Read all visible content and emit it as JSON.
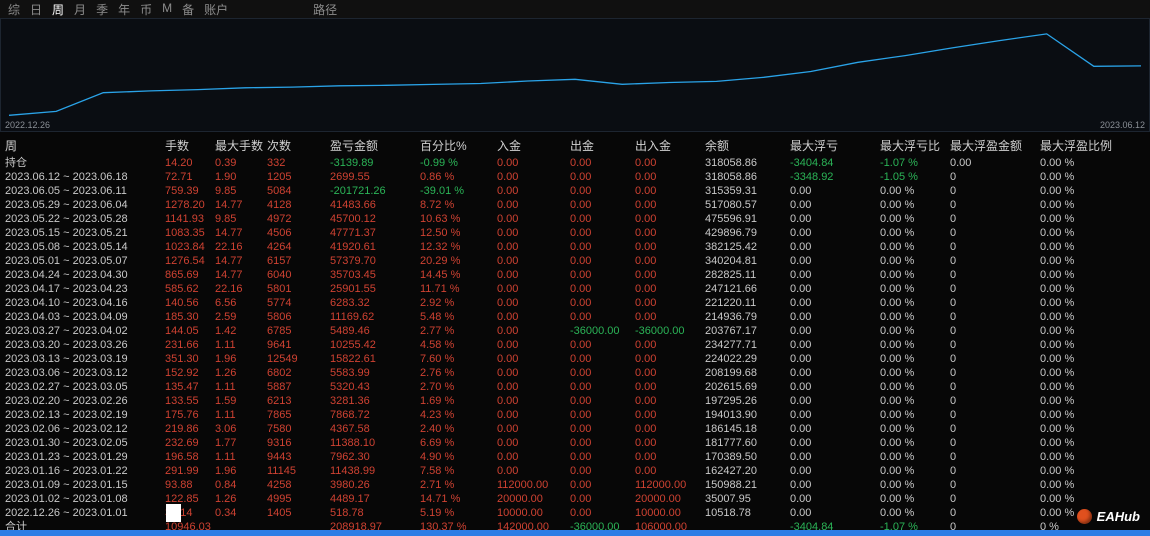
{
  "colors": {
    "positive": "#cf4232",
    "negative": "#2bb457",
    "neutral_text": "#c9c9c9",
    "menu_active": "#ffffff",
    "menu_inactive": "#8c8c8c",
    "chart_line": "#2aa3e8",
    "scrollbar": "#2e7de5",
    "logo_orange": "#e0501e"
  },
  "menu": {
    "tabs": [
      {
        "label": "综",
        "active": false
      },
      {
        "label": "日",
        "active": false
      },
      {
        "label": "周",
        "active": true
      },
      {
        "label": "月",
        "active": false
      },
      {
        "label": "季",
        "active": false
      },
      {
        "label": "年",
        "active": false
      },
      {
        "label": "币",
        "active": false
      },
      {
        "label": "M",
        "active": false
      },
      {
        "label": "备",
        "active": false
      },
      {
        "label": "账户",
        "active": false
      },
      {
        "label": "路径",
        "active": false,
        "gap_before": true
      }
    ]
  },
  "chart": {
    "start_date": "2022.12.26",
    "end_date": "2023.06.12"
  },
  "chart_data": {
    "type": "line",
    "title": "",
    "xlabel": "",
    "ylabel": "",
    "legend": false,
    "grid": false,
    "ylim": [
      0,
      560000
    ],
    "x": [
      "2023.01.01",
      "2023.01.08",
      "2023.01.15",
      "2023.01.22",
      "2023.01.29",
      "2023.02.05",
      "2023.02.12",
      "2023.02.19",
      "2023.02.26",
      "2023.03.05",
      "2023.03.12",
      "2023.03.19",
      "2023.03.26",
      "2023.04.02",
      "2023.04.09",
      "2023.04.16",
      "2023.04.23",
      "2023.04.30",
      "2023.05.07",
      "2023.05.14",
      "2023.05.21",
      "2023.05.28",
      "2023.06.04",
      "2023.06.11",
      "2023.06.18"
    ],
    "values": [
      10518.78,
      35007.95,
      150988.21,
      162427.2,
      170389.5,
      181777.6,
      186145.18,
      194013.9,
      197295.26,
      202615.69,
      208199.68,
      224022.29,
      234277.71,
      203767.17,
      214936.79,
      221220.11,
      247121.66,
      282825.11,
      340204.81,
      382125.42,
      429896.79,
      475596.91,
      517080.57,
      315359.31,
      318058.86
    ]
  },
  "table": {
    "headers": [
      "周",
      "手数",
      "最大手数",
      "次数",
      "盈亏金额",
      "百分比%",
      "入金",
      "出金",
      "出入金",
      "余额",
      "最大浮亏",
      "最大浮亏比",
      "最大浮盈金额",
      "最大浮盈比例"
    ],
    "rows": [
      [
        "持仓",
        "14.20",
        "0.39",
        "332",
        "-3139.89",
        "-0.99 %",
        "0.00",
        "0.00",
        "0.00",
        "318058.86",
        "-3404.84",
        "-1.07 %",
        "0.00",
        "0.00 %"
      ],
      [
        "2023.06.12 ~ 2023.06.18",
        "72.71",
        "1.90",
        "1205",
        "2699.55",
        "0.86 %",
        "0.00",
        "0.00",
        "0.00",
        "318058.86",
        "-3348.92",
        "-1.05 %",
        "0",
        "0.00 %"
      ],
      [
        "2023.06.05 ~ 2023.06.11",
        "759.39",
        "9.85",
        "5084",
        "-201721.26",
        "-39.01 %",
        "0.00",
        "0.00",
        "0.00",
        "315359.31",
        "0.00",
        "0.00 %",
        "0",
        "0.00 %"
      ],
      [
        "2023.05.29 ~ 2023.06.04",
        "1278.20",
        "14.77",
        "4128",
        "41483.66",
        "8.72 %",
        "0.00",
        "0.00",
        "0.00",
        "517080.57",
        "0.00",
        "0.00 %",
        "0",
        "0.00 %"
      ],
      [
        "2023.05.22 ~ 2023.05.28",
        "1141.93",
        "9.85",
        "4972",
        "45700.12",
        "10.63 %",
        "0.00",
        "0.00",
        "0.00",
        "475596.91",
        "0.00",
        "0.00 %",
        "0",
        "0.00 %"
      ],
      [
        "2023.05.15 ~ 2023.05.21",
        "1083.35",
        "14.77",
        "4506",
        "47771.37",
        "12.50 %",
        "0.00",
        "0.00",
        "0.00",
        "429896.79",
        "0.00",
        "0.00 %",
        "0",
        "0.00 %"
      ],
      [
        "2023.05.08 ~ 2023.05.14",
        "1023.84",
        "22.16",
        "4264",
        "41920.61",
        "12.32 %",
        "0.00",
        "0.00",
        "0.00",
        "382125.42",
        "0.00",
        "0.00 %",
        "0",
        "0.00 %"
      ],
      [
        "2023.05.01 ~ 2023.05.07",
        "1276.54",
        "14.77",
        "6157",
        "57379.70",
        "20.29 %",
        "0.00",
        "0.00",
        "0.00",
        "340204.81",
        "0.00",
        "0.00 %",
        "0",
        "0.00 %"
      ],
      [
        "2023.04.24 ~ 2023.04.30",
        "865.69",
        "14.77",
        "6040",
        "35703.45",
        "14.45 %",
        "0.00",
        "0.00",
        "0.00",
        "282825.11",
        "0.00",
        "0.00 %",
        "0",
        "0.00 %"
      ],
      [
        "2023.04.17 ~ 2023.04.23",
        "585.62",
        "22.16",
        "5801",
        "25901.55",
        "11.71 %",
        "0.00",
        "0.00",
        "0.00",
        "247121.66",
        "0.00",
        "0.00 %",
        "0",
        "0.00 %"
      ],
      [
        "2023.04.10 ~ 2023.04.16",
        "140.56",
        "6.56",
        "5774",
        "6283.32",
        "2.92 %",
        "0.00",
        "0.00",
        "0.00",
        "221220.11",
        "0.00",
        "0.00 %",
        "0",
        "0.00 %"
      ],
      [
        "2023.04.03 ~ 2023.04.09",
        "185.30",
        "2.59",
        "5806",
        "11169.62",
        "5.48 %",
        "0.00",
        "0.00",
        "0.00",
        "214936.79",
        "0.00",
        "0.00 %",
        "0",
        "0.00 %"
      ],
      [
        "2023.03.27 ~ 2023.04.02",
        "144.05",
        "1.42",
        "6785",
        "5489.46",
        "2.77 %",
        "0.00",
        "-36000.00",
        "-36000.00",
        "203767.17",
        "0.00",
        "0.00 %",
        "0",
        "0.00 %"
      ],
      [
        "2023.03.20 ~ 2023.03.26",
        "231.66",
        "1.11",
        "9641",
        "10255.42",
        "4.58 %",
        "0.00",
        "0.00",
        "0.00",
        "234277.71",
        "0.00",
        "0.00 %",
        "0",
        "0.00 %"
      ],
      [
        "2023.03.13 ~ 2023.03.19",
        "351.30",
        "1.96",
        "12549",
        "15822.61",
        "7.60 %",
        "0.00",
        "0.00",
        "0.00",
        "224022.29",
        "0.00",
        "0.00 %",
        "0",
        "0.00 %"
      ],
      [
        "2023.03.06 ~ 2023.03.12",
        "152.92",
        "1.26",
        "6802",
        "5583.99",
        "2.76 %",
        "0.00",
        "0.00",
        "0.00",
        "208199.68",
        "0.00",
        "0.00 %",
        "0",
        "0.00 %"
      ],
      [
        "2023.02.27 ~ 2023.03.05",
        "135.47",
        "1.11",
        "5887",
        "5320.43",
        "2.70 %",
        "0.00",
        "0.00",
        "0.00",
        "202615.69",
        "0.00",
        "0.00 %",
        "0",
        "0.00 %"
      ],
      [
        "2023.02.20 ~ 2023.02.26",
        "133.55",
        "1.59",
        "6213",
        "3281.36",
        "1.69 %",
        "0.00",
        "0.00",
        "0.00",
        "197295.26",
        "0.00",
        "0.00 %",
        "0",
        "0.00 %"
      ],
      [
        "2023.02.13 ~ 2023.02.19",
        "175.76",
        "1.11",
        "7865",
        "7868.72",
        "4.23 %",
        "0.00",
        "0.00",
        "0.00",
        "194013.90",
        "0.00",
        "0.00 %",
        "0",
        "0.00 %"
      ],
      [
        "2023.02.06 ~ 2023.02.12",
        "219.86",
        "3.06",
        "7580",
        "4367.58",
        "2.40 %",
        "0.00",
        "0.00",
        "0.00",
        "186145.18",
        "0.00",
        "0.00 %",
        "0",
        "0.00 %"
      ],
      [
        "2023.01.30 ~ 2023.02.05",
        "232.69",
        "1.77",
        "9316",
        "11388.10",
        "6.69 %",
        "0.00",
        "0.00",
        "0.00",
        "181777.60",
        "0.00",
        "0.00 %",
        "0",
        "0.00 %"
      ],
      [
        "2023.01.23 ~ 2023.01.29",
        "196.58",
        "1.11",
        "9443",
        "7962.30",
        "4.90 %",
        "0.00",
        "0.00",
        "0.00",
        "170389.50",
        "0.00",
        "0.00 %",
        "0",
        "0.00 %"
      ],
      [
        "2023.01.16 ~ 2023.01.22",
        "291.99",
        "1.96",
        "11145",
        "11438.99",
        "7.58 %",
        "0.00",
        "0.00",
        "0.00",
        "162427.20",
        "0.00",
        "0.00 %",
        "0",
        "0.00 %"
      ],
      [
        "2023.01.09 ~ 2023.01.15",
        "93.88",
        "0.84",
        "4258",
        "3980.26",
        "2.71 %",
        "112000.00",
        "0.00",
        "112000.00",
        "150988.21",
        "0.00",
        "0.00 %",
        "0",
        "0.00 %"
      ],
      [
        "2023.01.02 ~ 2023.01.08",
        "122.85",
        "1.26",
        "4995",
        "4489.17",
        "14.71 %",
        "20000.00",
        "0.00",
        "20000.00",
        "35007.95",
        "0.00",
        "0.00 %",
        "0",
        "0.00 %"
      ],
      [
        "2022.12.26 ~ 2023.01.01",
        "36.14",
        "0.34",
        "1405",
        "518.78",
        "5.19 %",
        "10000.00",
        "0.00",
        "10000.00",
        "10518.78",
        "0.00",
        "0.00 %",
        "0",
        "0.00 %"
      ]
    ],
    "total_row": [
      "合计",
      "10946.03",
      "",
      "",
      "208918.97",
      "130.37 %",
      "142000.00",
      "-36000.00",
      "106000.00",
      "",
      "-3404.84",
      "-1.07 %",
      "0",
      "0 %"
    ]
  },
  "logo": {
    "text": "EAHub"
  }
}
